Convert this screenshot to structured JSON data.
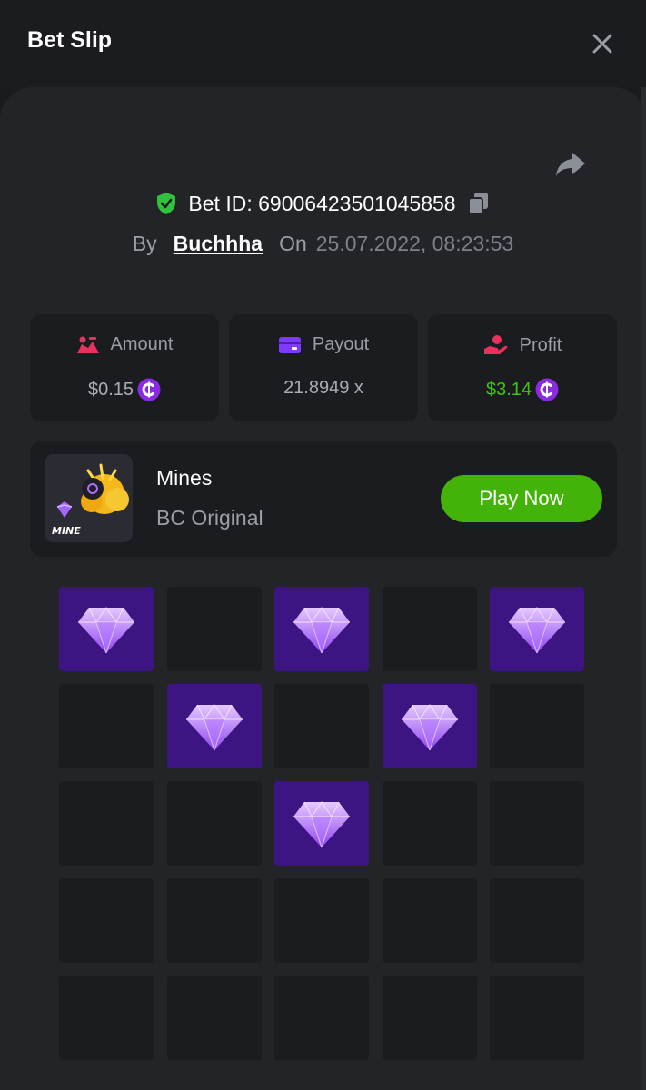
{
  "header": {
    "title": "Bet Slip"
  },
  "bet": {
    "id_text": "Bet ID: 69006423501045858",
    "by_label": "By",
    "username": "Buchhha",
    "on_label": "On",
    "datetime": "25.07.2022, 08:23:53"
  },
  "stats": {
    "amount": {
      "label": "Amount",
      "value": "$0.15"
    },
    "payout": {
      "label": "Payout",
      "value": "21.8949 x"
    },
    "profit": {
      "label": "Profit",
      "value": "$3.14"
    }
  },
  "game": {
    "name": "Mines",
    "provider": "BC Original",
    "thumb_label": "MINE",
    "play_label": "Play Now"
  },
  "board": {
    "rows": 5,
    "cols": 5,
    "tiles": [
      "gem",
      "empty",
      "gem",
      "empty",
      "gem",
      "empty",
      "gem",
      "empty",
      "gem",
      "empty",
      "empty",
      "empty",
      "gem",
      "empty",
      "empty",
      "empty",
      "empty",
      "empty",
      "empty",
      "empty",
      "empty",
      "empty",
      "empty",
      "empty",
      "empty"
    ]
  },
  "colors": {
    "accent_green": "#43b309",
    "profit_green": "#41c30d",
    "gem_tile": "#3d1582",
    "coin_purple": "#8a2be2"
  },
  "icons": {
    "close": "close-icon",
    "share": "share-icon",
    "shield": "shield-check-icon",
    "copy": "copy-icon",
    "amount": "amount-icon",
    "payout": "wallet-icon",
    "profit": "profit-hand-icon",
    "coin": "coin-icon",
    "gem": "gem-icon"
  }
}
